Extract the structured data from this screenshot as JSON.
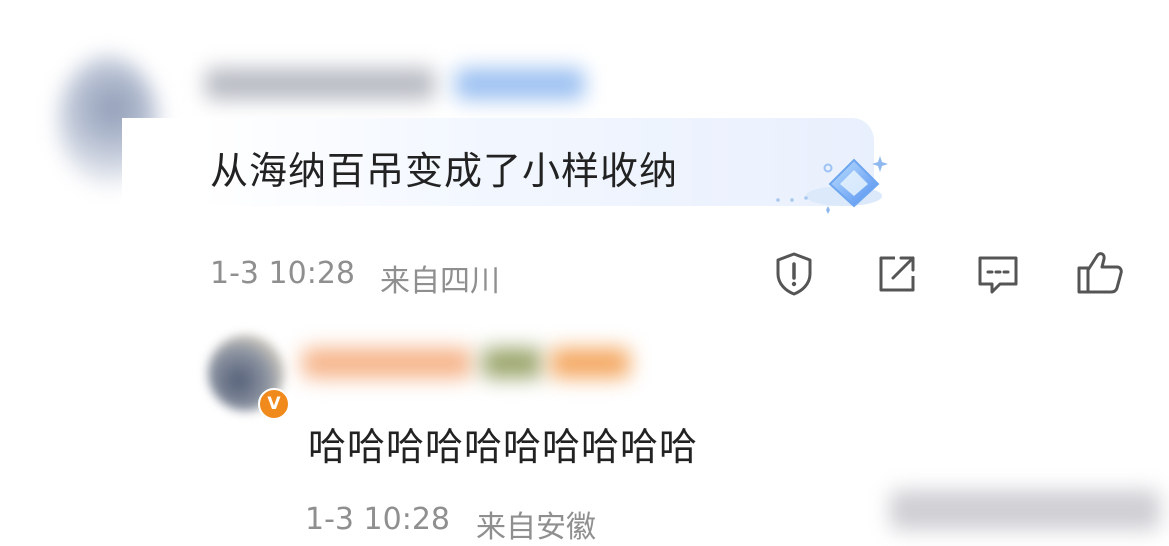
{
  "comments": [
    {
      "text": "从海纳百吊变成了小样收纳",
      "time": "1-3 10:28",
      "location": "来自四川"
    },
    {
      "text": "哈哈哈哈哈哈哈哈哈哈",
      "time": "1-3 10:28",
      "location": "来自安徽",
      "badge": "V"
    }
  ],
  "icons": {
    "report": "shield-exclamation-icon",
    "share": "share-arrow-icon",
    "comment": "comment-bubble-icon",
    "like": "thumbs-up-icon",
    "decoration": "diamond-sparkle-icon"
  },
  "colors": {
    "text": "#222222",
    "meta": "#8f8f8f",
    "icon": "#555555",
    "badge": "#f08a1d",
    "bubble": "#e9f0fd"
  }
}
